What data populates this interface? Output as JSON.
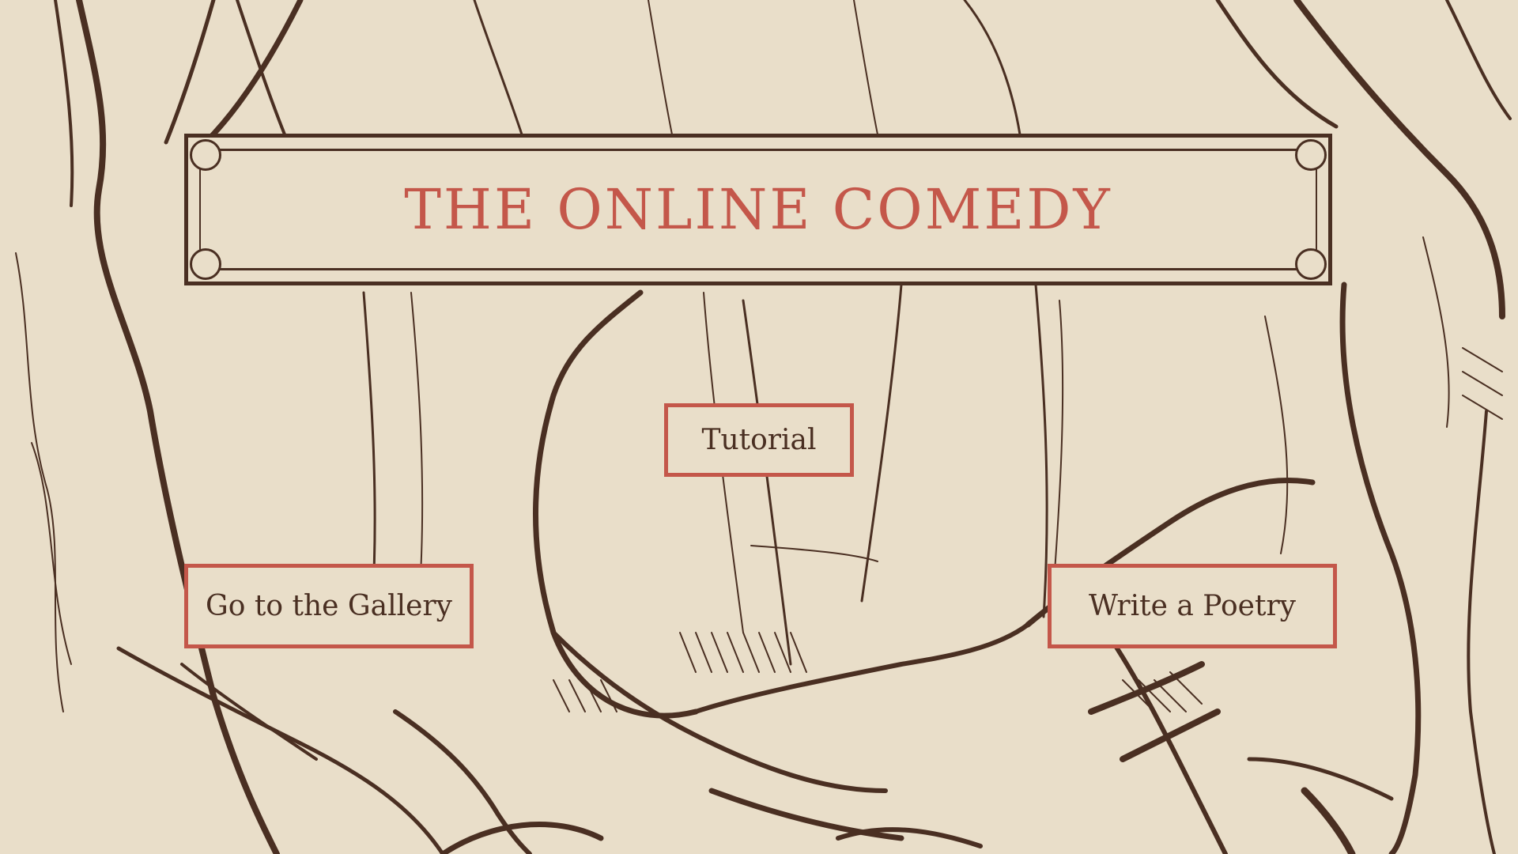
{
  "app": {
    "title": "THE ONLINE COMEDY"
  },
  "menu": {
    "tutorial_label": "Tutorial",
    "gallery_label": "Go to the Gallery",
    "poetry_label": "Write a Poetry"
  },
  "colors": {
    "background": "#e9dec9",
    "ink": "#4a2f22",
    "accent": "#c4574a"
  }
}
